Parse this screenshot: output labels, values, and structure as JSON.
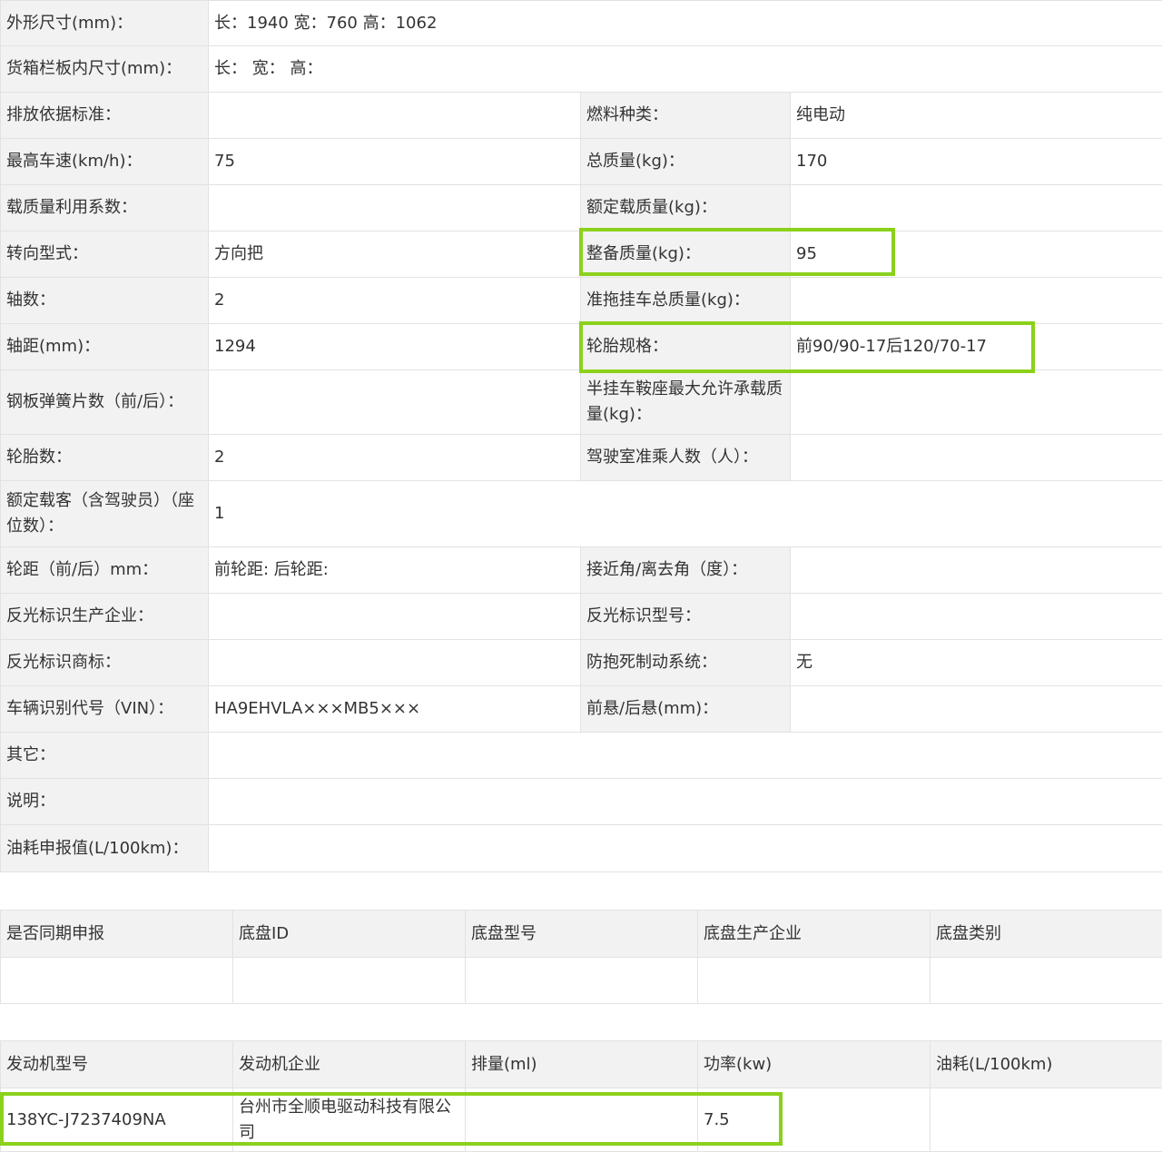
{
  "spec": {
    "dimensions": {
      "label": "外形尺寸(mm)：",
      "value": "长：1940 宽：760 高：1062"
    },
    "cargo_box": {
      "label": "货箱栏板内尺寸(mm)：",
      "value": "长：  宽：  高："
    },
    "emission_standard": {
      "label": "排放依据标准：",
      "value": ""
    },
    "fuel_type": {
      "label": "燃料种类：",
      "value": "纯电动"
    },
    "max_speed": {
      "label": "最高车速(km/h)：",
      "value": "75"
    },
    "total_mass": {
      "label": "总质量(kg)：",
      "value": "170"
    },
    "load_util": {
      "label": "载质量利用系数：",
      "value": ""
    },
    "rated_load": {
      "label": "额定载质量(kg)：",
      "value": ""
    },
    "steering": {
      "label": "转向型式：",
      "value": "方向把"
    },
    "curb_mass": {
      "label": "整备质量(kg)：",
      "value": "95"
    },
    "axles": {
      "label": "轴数：",
      "value": "2"
    },
    "trailer_mass": {
      "label": "准拖挂车总质量(kg)：",
      "value": ""
    },
    "wheelbase": {
      "label": "轴距(mm)：",
      "value": "1294"
    },
    "tire_spec": {
      "label": "轮胎规格：",
      "value": "前90/90-17后120/70-17"
    },
    "leaf_springs": {
      "label": "钢板弹簧片数（前/后）：",
      "value": ""
    },
    "saddle_load": {
      "label": "半挂车鞍座最大允许承载质量(kg)：",
      "value": ""
    },
    "tire_count": {
      "label": "轮胎数：",
      "value": "2"
    },
    "cab_passengers": {
      "label": "驾驶室准乘人数（人）：",
      "value": ""
    },
    "seats": {
      "label": "额定载客（含驾驶员）（座位数）：",
      "value": "1"
    },
    "track": {
      "label": "轮距（前/后）mm：",
      "value": "前轮距: 后轮距:"
    },
    "angles": {
      "label": "接近角/离去角（度）：",
      "value": ""
    },
    "reflector_maker": {
      "label": "反光标识生产企业：",
      "value": ""
    },
    "reflector_model": {
      "label": "反光标识型号：",
      "value": ""
    },
    "reflector_brand": {
      "label": "反光标识商标：",
      "value": ""
    },
    "abs": {
      "label": "防抱死制动系统：",
      "value": "无"
    },
    "vin": {
      "label": "车辆识别代号（VIN）：",
      "value": "HA9EHVLA×××MB5×××"
    },
    "overhang": {
      "label": "前悬/后悬(mm)：",
      "value": ""
    },
    "other": {
      "label": "其它：",
      "value": ""
    },
    "notes": {
      "label": "说明：",
      "value": ""
    },
    "fuel_consumption": {
      "label": "油耗申报值(L/100km)：",
      "value": ""
    }
  },
  "chassis": {
    "headers": [
      "是否同期申报",
      "底盘ID",
      "底盘型号",
      "底盘生产企业",
      "底盘类别"
    ],
    "rows": [
      [
        "",
        "",
        "",
        "",
        ""
      ]
    ]
  },
  "engine": {
    "headers": [
      "发动机型号",
      "发动机企业",
      "排量(ml)",
      "功率(kw)",
      "油耗(L/100km)"
    ],
    "rows": [
      [
        "138YC-J7237409NA",
        "台州市全顺电驱动科技有限公司",
        "",
        "7.5",
        ""
      ]
    ]
  },
  "highlight_color": "#8bd11b"
}
